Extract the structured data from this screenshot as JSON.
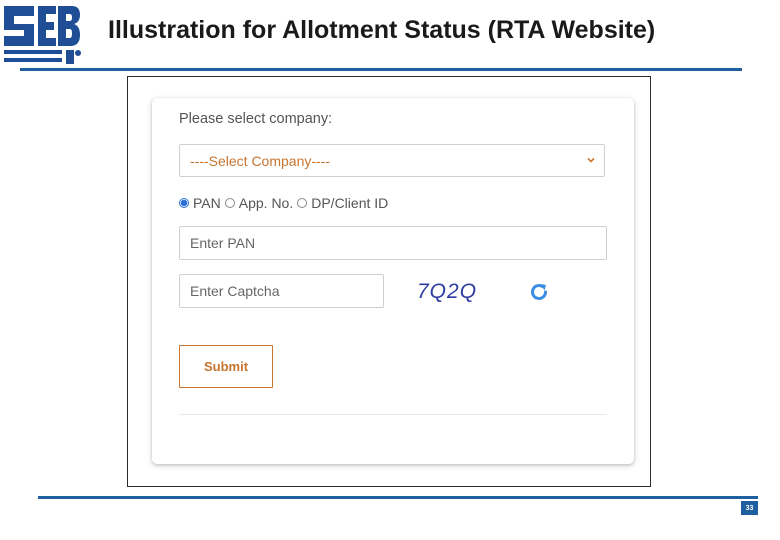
{
  "logo": {
    "text": "SEBI",
    "color": "#1f4e96"
  },
  "slide": {
    "title": "Illustration for Allotment Status (RTA Website)",
    "page_number": "33"
  },
  "form": {
    "company_label": "Please select company:",
    "company_select_value": "----Select Company----",
    "radio_options": [
      "PAN",
      "App. No.",
      "DP/Client ID"
    ],
    "radio_selected": "PAN",
    "pan_placeholder": "Enter PAN",
    "captcha_placeholder": "Enter Captcha",
    "captcha_code": "7Q2Q",
    "submit_label": "Submit"
  },
  "icons": {
    "select": "chevron-down-icon",
    "captcha_refresh": "refresh-icon"
  },
  "colors": {
    "accent_orange": "#c7752f",
    "rule_blue": "#1f5f9f",
    "captcha_blue": "#2e3da0",
    "refresh_blue": "#3a8de0",
    "radio_blue": "#2a6fd6"
  }
}
